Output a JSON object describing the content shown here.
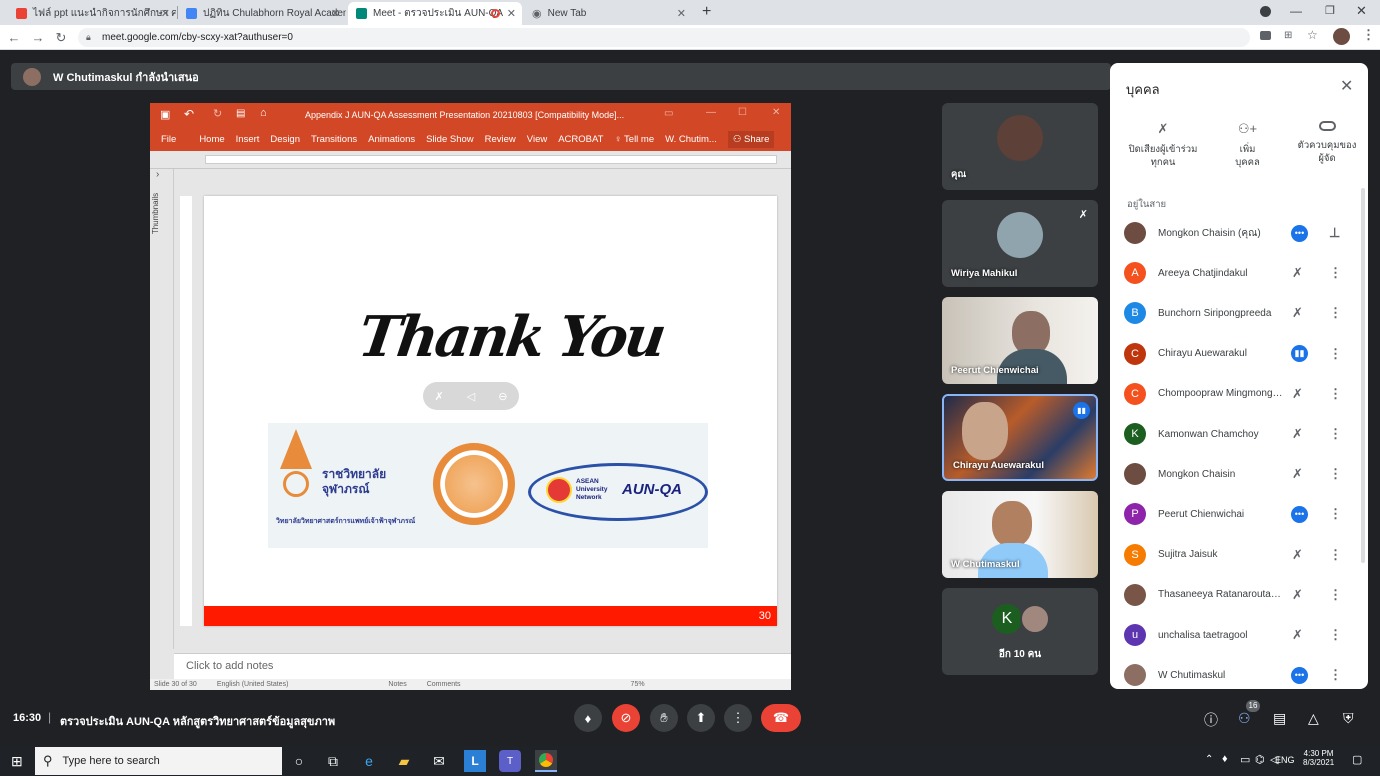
{
  "browser": {
    "tabs": [
      {
        "label": "ไฟล์ ppt แนะนำกิจการนักศึกษา คณะ...",
        "favicon": "gmail-icon"
      },
      {
        "label": "ปฏิทิน Chulabhorn Royal Academ...",
        "favicon": "calendar-icon"
      },
      {
        "label": "Meet - ตรวจประเมิน AUN-QA",
        "favicon": "meet-icon"
      },
      {
        "label": "New Tab",
        "favicon": "globe-icon"
      }
    ],
    "url": "meet.google.com/cby-scxy-xat?authuser=0"
  },
  "presenter_bar": {
    "text": "W Chutimaskul กำลังนำเสนอ"
  },
  "ppt": {
    "title": "Appendix J AUN-QA Assessment Presentation 20210803 [Compatibility Mode]...",
    "ribbon": [
      "File",
      "Home",
      "Insert",
      "Design",
      "Transitions",
      "Animations",
      "Slide Show",
      "Review",
      "View",
      "ACROBAT",
      "Tell me",
      "W. Chutim...",
      "Share"
    ],
    "thumbnails_label": "Thumbnails",
    "slide": {
      "headline": "Thank You",
      "college_name": "ราชวิทยาลัย\nจุฬาภรณ์",
      "faculty_name": "วิทยาลัยวิทยาศาสตร์การแพทย์เจ้าฟ้าจุฬาภรณ์",
      "asean_line1": "ASEAN",
      "asean_line2": "University",
      "asean_line3": "Network",
      "aunqa": "AUN-QA",
      "page_number": "30"
    },
    "notes_placeholder": "Click to add notes",
    "status": [
      "Slide 30 of 30",
      "English (United States)",
      "Notes",
      "Comments",
      "75%"
    ]
  },
  "tiles": [
    {
      "name": "คุณ"
    },
    {
      "name": "Wiriya Mahikul"
    },
    {
      "name": "Peerut Chienwichai"
    },
    {
      "name": "Chirayu Auewarakul"
    },
    {
      "name": "W Chutimaskul"
    },
    {
      "name": "อีก 10 คน",
      "initial": "K"
    }
  ],
  "people_panel": {
    "title": "บุคคล",
    "actions": [
      {
        "label": "ปิดเสียงผู้เข้าร่วม\nทุกคน",
        "icon": "mic-off-icon"
      },
      {
        "label": "เพิ่ม\nบุคคล",
        "icon": "add-person-icon"
      },
      {
        "label": "ตัวควบคุมของ\nผู้จัด",
        "icon": "toggle-icon"
      }
    ],
    "section_label": "อยู่ในสาย",
    "people": [
      {
        "name": "Mongkon Chaisin (คุณ)",
        "initial": "",
        "color": "#6d4c41",
        "state": "speaking-dots",
        "action": "pin"
      },
      {
        "name": "Areeya Chatjindakul",
        "initial": "A",
        "color": "#f4511e",
        "state": "muted"
      },
      {
        "name": "Bunchorn Siripongpreeda",
        "initial": "B",
        "color": "#1e88e5",
        "state": "muted"
      },
      {
        "name": "Chirayu Auewarakul",
        "initial": "C",
        "color": "#bf360c",
        "state": "speaking"
      },
      {
        "name": "Chompoopraw Mingmongkol",
        "initial": "C",
        "color": "#f4511e",
        "state": "muted"
      },
      {
        "name": "Kamonwan Chamchoy",
        "initial": "K",
        "color": "#1b5e20",
        "state": "muted"
      },
      {
        "name": "Mongkon Chaisin",
        "initial": "",
        "color": "#6d4c41",
        "state": "muted"
      },
      {
        "name": "Peerut Chienwichai",
        "initial": "P",
        "color": "#8e24aa",
        "state": "speaking-dots"
      },
      {
        "name": "Sujitra Jaisuk",
        "initial": "S",
        "color": "#f57c00",
        "state": "muted"
      },
      {
        "name": "Thasaneeya Ratanaroutai ...",
        "initial": "",
        "color": "#795548",
        "state": "muted"
      },
      {
        "name": "unchalisa taetragool",
        "initial": "u",
        "color": "#5e35b1",
        "state": "muted"
      },
      {
        "name": "W Chutimaskul",
        "initial": "",
        "color": "#8d6e63",
        "state": "speaking-dots"
      }
    ]
  },
  "meeting": {
    "time": "16:30",
    "title": "ตรวจประเมิน AUN-QA หลักสูตรวิทยาศาสตร์ข้อมูลสุขภาพ",
    "participant_count": "16"
  },
  "taskbar": {
    "search_placeholder": "Type here to search",
    "lang": "ENG",
    "clock_time": "4:30 PM",
    "clock_date": "8/3/2021"
  },
  "colors": {
    "accent": "#1a73e8",
    "danger": "#ea4335",
    "ppt": "#d24726"
  }
}
